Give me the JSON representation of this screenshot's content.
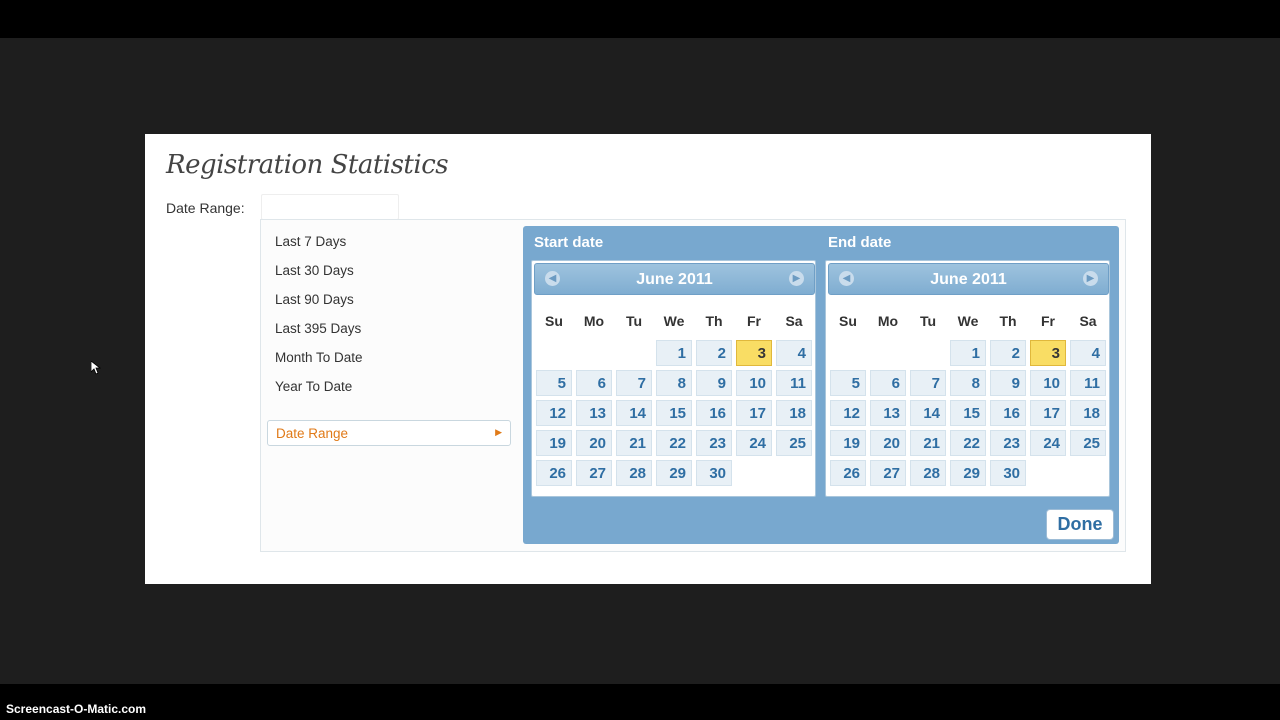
{
  "page": {
    "title": "Registration Statistics",
    "date_range_label": "Date Range:",
    "date_range_value": ""
  },
  "presets": {
    "items": [
      "Last 7 Days",
      "Last 30 Days",
      "Last 90 Days",
      "Last 395 Days",
      "Month To Date",
      "Year To Date"
    ],
    "active": "Date Range"
  },
  "calendars": {
    "weekdays": [
      "Su",
      "Mo",
      "Tu",
      "We",
      "Th",
      "Fr",
      "Sa"
    ],
    "start": {
      "title": "Start date",
      "month": "June 2011",
      "first_weekday": 3,
      "days_in_month": 30,
      "selected": 3
    },
    "end": {
      "title": "End date",
      "month": "June 2011",
      "first_weekday": 3,
      "days_in_month": 30,
      "selected": 3
    }
  },
  "buttons": {
    "done": "Done"
  },
  "icons": {
    "prev": "chevron-left-icon",
    "next": "chevron-right-icon",
    "preset_arrow": "triangle-right-icon",
    "cursor": "mouse-pointer-icon"
  },
  "colors": {
    "accent_blue": "#78a8cf",
    "highlight_yellow": "#f9dd64",
    "active_preset": "#e07a18"
  },
  "watermark": "Screencast-O-Matic.com"
}
